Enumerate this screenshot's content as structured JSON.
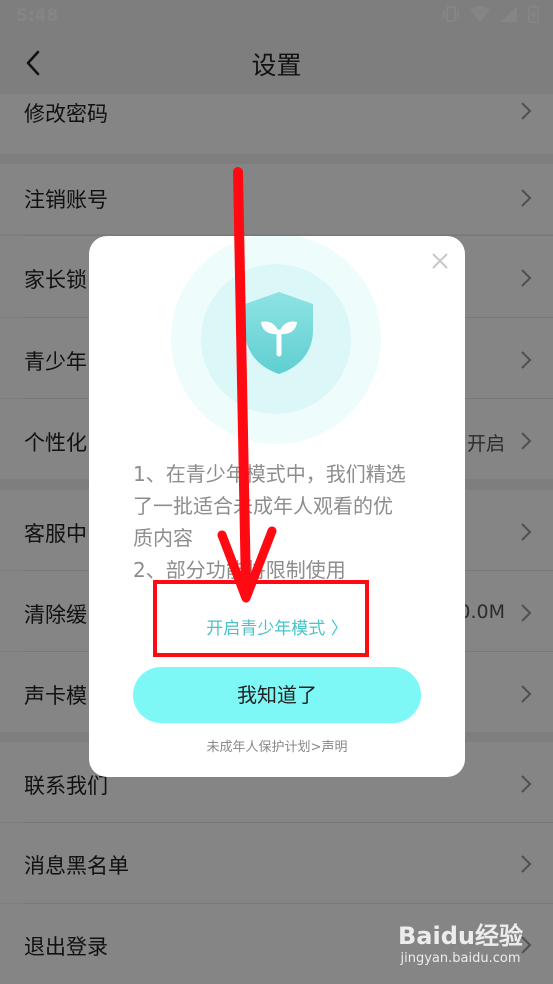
{
  "status_bar": {
    "time": "5:48"
  },
  "header": {
    "title": "设置"
  },
  "settings_items": [
    {
      "label": "修改密码",
      "value": ""
    },
    {
      "label": "注销账号",
      "value": ""
    },
    {
      "label": "家长锁",
      "value": ""
    },
    {
      "label": "青少年",
      "value": ""
    },
    {
      "label": "个性化",
      "value": "开启"
    },
    {
      "label": "客服中",
      "value": ""
    },
    {
      "label": "清除缓",
      "value": "0.0M"
    },
    {
      "label": "声卡模",
      "value": ""
    },
    {
      "label": "联系我们",
      "value": ""
    },
    {
      "label": "消息黑名单",
      "value": ""
    },
    {
      "label": "退出登录",
      "value": ""
    }
  ],
  "modal": {
    "text_lines": [
      "1、在青少年模式中，我们精选",
      "了一批适合未成年人观看的优",
      "质内容",
      "2、部分功能将限制使用"
    ],
    "enable_link": "开启青少年模式 〉",
    "confirm_button": "我知道了",
    "footer_link": "未成年人保护计划>声明"
  },
  "watermark": {
    "logo": "Baidu经验",
    "url": "jingyan.baidu.com"
  },
  "colors": {
    "accent": "#46c4c8",
    "button_bg": "#7ef8f6",
    "annotation": "#ff0a12"
  }
}
